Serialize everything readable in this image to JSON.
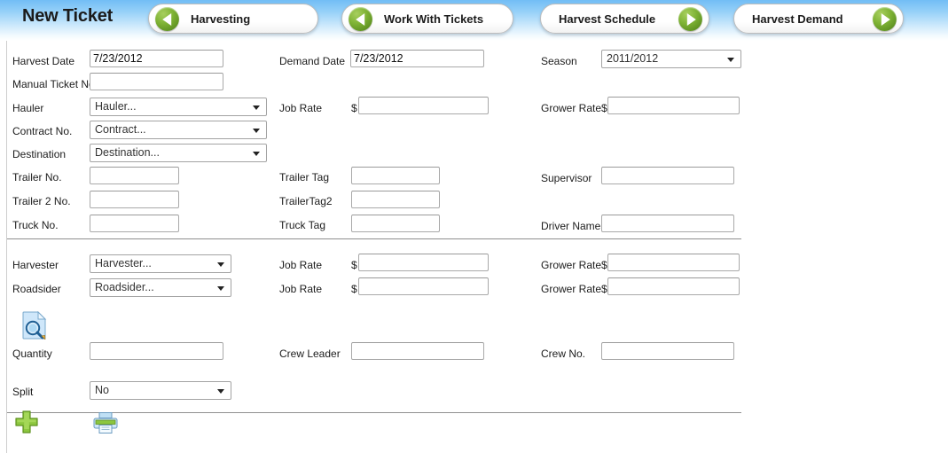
{
  "header": {
    "title": "New Ticket",
    "nav": [
      {
        "label": "Harvesting",
        "direction": "back",
        "icon": "arrow-left-icon"
      },
      {
        "label": "Work With Tickets",
        "direction": "back",
        "icon": "arrow-left-icon"
      },
      {
        "label": "Harvest Schedule",
        "direction": "forward",
        "icon": "arrow-right-icon"
      },
      {
        "label": "Harvest Demand",
        "direction": "forward",
        "icon": "arrow-right-icon"
      }
    ]
  },
  "form": {
    "harvest_date": {
      "label": "Harvest Date",
      "value": "7/23/2012"
    },
    "manual_ticket_no": {
      "label": "Manual Ticket No.",
      "value": ""
    },
    "hauler": {
      "label": "Hauler",
      "value": "Hauler..."
    },
    "contract_no": {
      "label": "Contract No.",
      "value": "Contract..."
    },
    "destination": {
      "label": "Destination",
      "value": "Destination..."
    },
    "demand_date": {
      "label": "Demand Date",
      "value": "7/23/2012"
    },
    "hauler_job_rate": {
      "label": "Job Rate",
      "currency": "$",
      "value": ""
    },
    "season": {
      "label": "Season",
      "value": "2011/2012"
    },
    "hauler_grower_rate": {
      "label": "Grower Rate",
      "currency": "$",
      "value": ""
    },
    "trailer_no": {
      "label": "Trailer No.",
      "value": ""
    },
    "trailer2_no": {
      "label": "Trailer 2 No.",
      "value": ""
    },
    "truck_no": {
      "label": "Truck No.",
      "value": ""
    },
    "trailer_tag": {
      "label": "Trailer Tag",
      "value": ""
    },
    "trailer_tag2": {
      "label": "TrailerTag2",
      "value": ""
    },
    "truck_tag": {
      "label": "Truck Tag",
      "value": ""
    },
    "supervisor": {
      "label": "Supervisor",
      "value": ""
    },
    "driver_name": {
      "label": "Driver Name",
      "value": ""
    },
    "harvester": {
      "label": "Harvester",
      "value": "Harvester..."
    },
    "roadsider": {
      "label": "Roadsider",
      "value": "Roadsider..."
    },
    "harvester_job_rate": {
      "label": "Job Rate",
      "currency": "$",
      "value": ""
    },
    "roadsider_job_rate": {
      "label": "Job Rate",
      "currency": "$",
      "value": ""
    },
    "harvester_grower_rate": {
      "label": "Grower Rate",
      "currency": "$",
      "value": ""
    },
    "roadsider_grower_rate": {
      "label": "Grower Rate",
      "currency": "$",
      "value": ""
    },
    "quantity": {
      "label": "Quantity",
      "value": ""
    },
    "crew_leader": {
      "label": "Crew Leader",
      "value": ""
    },
    "crew_no": {
      "label": "Crew No.",
      "value": ""
    },
    "split": {
      "label": "Split",
      "value": "No"
    }
  },
  "icons": {
    "document_search": "document-search-icon",
    "add": "add-icon",
    "print": "print-icon"
  },
  "colors": {
    "header_blue": "#72bdf5",
    "accent_green": "#7fb335",
    "add_green": "#8cc63f",
    "separator": "#8f8f8f",
    "field_border": "#a9a9a9"
  }
}
